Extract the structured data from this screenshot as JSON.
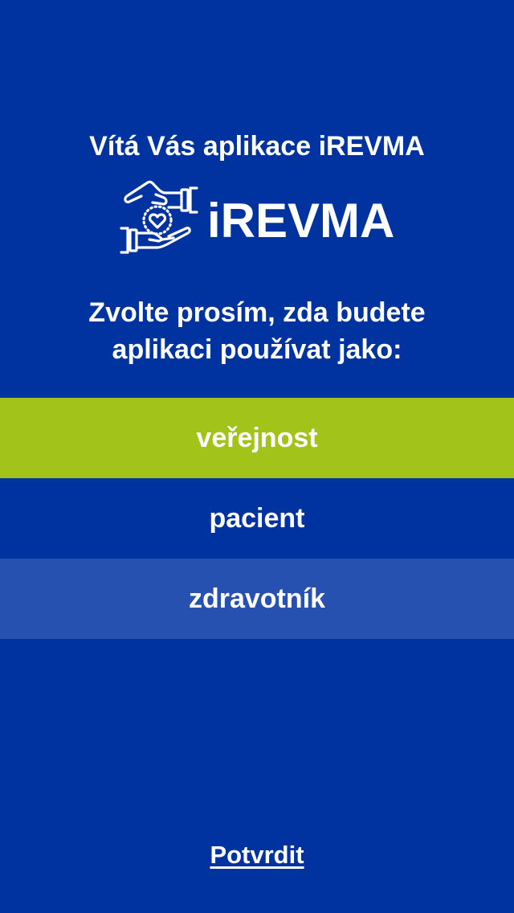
{
  "header": {
    "welcome": "Vítá Vás aplikace iREVMA"
  },
  "logo": {
    "icon": "hands-heart-icon",
    "text": "iREVMA"
  },
  "prompt": {
    "line1": "Zvolte prosím, zda budete",
    "line2": "aplikaci používat jako:"
  },
  "roles": [
    {
      "label": "veřejnost",
      "selected": true
    },
    {
      "label": "pacient",
      "selected": false
    },
    {
      "label": "zdravotník",
      "selected": false
    }
  ],
  "footer": {
    "confirm_label": "Potvrdit"
  },
  "colors": {
    "background": "#0033a0",
    "selected": "#a2c41a",
    "alt_row": "#2751b0",
    "text": "#ffffff"
  }
}
